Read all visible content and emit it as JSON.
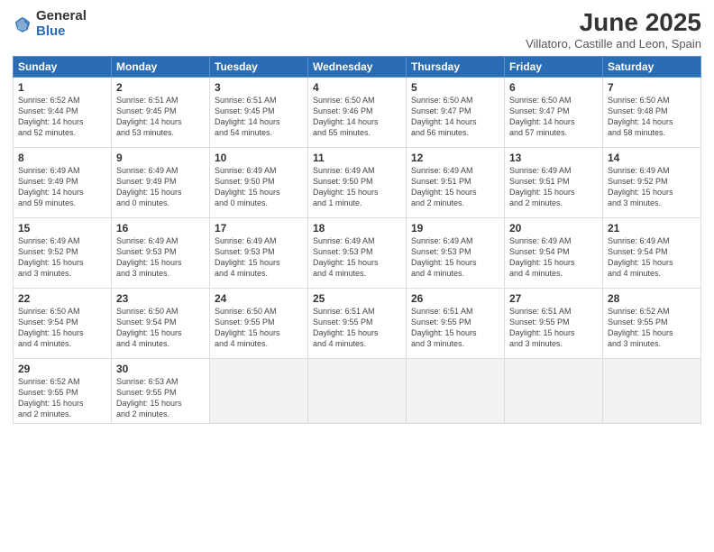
{
  "logo": {
    "general": "General",
    "blue": "Blue"
  },
  "title": "June 2025",
  "subtitle": "Villatoro, Castille and Leon, Spain",
  "headers": [
    "Sunday",
    "Monday",
    "Tuesday",
    "Wednesday",
    "Thursday",
    "Friday",
    "Saturday"
  ],
  "weeks": [
    [
      {
        "day": "1",
        "info": "Sunrise: 6:52 AM\nSunset: 9:44 PM\nDaylight: 14 hours\nand 52 minutes."
      },
      {
        "day": "2",
        "info": "Sunrise: 6:51 AM\nSunset: 9:45 PM\nDaylight: 14 hours\nand 53 minutes."
      },
      {
        "day": "3",
        "info": "Sunrise: 6:51 AM\nSunset: 9:45 PM\nDaylight: 14 hours\nand 54 minutes."
      },
      {
        "day": "4",
        "info": "Sunrise: 6:50 AM\nSunset: 9:46 PM\nDaylight: 14 hours\nand 55 minutes."
      },
      {
        "day": "5",
        "info": "Sunrise: 6:50 AM\nSunset: 9:47 PM\nDaylight: 14 hours\nand 56 minutes."
      },
      {
        "day": "6",
        "info": "Sunrise: 6:50 AM\nSunset: 9:47 PM\nDaylight: 14 hours\nand 57 minutes."
      },
      {
        "day": "7",
        "info": "Sunrise: 6:50 AM\nSunset: 9:48 PM\nDaylight: 14 hours\nand 58 minutes."
      }
    ],
    [
      {
        "day": "8",
        "info": "Sunrise: 6:49 AM\nSunset: 9:49 PM\nDaylight: 14 hours\nand 59 minutes."
      },
      {
        "day": "9",
        "info": "Sunrise: 6:49 AM\nSunset: 9:49 PM\nDaylight: 15 hours\nand 0 minutes."
      },
      {
        "day": "10",
        "info": "Sunrise: 6:49 AM\nSunset: 9:50 PM\nDaylight: 15 hours\nand 0 minutes."
      },
      {
        "day": "11",
        "info": "Sunrise: 6:49 AM\nSunset: 9:50 PM\nDaylight: 15 hours\nand 1 minute."
      },
      {
        "day": "12",
        "info": "Sunrise: 6:49 AM\nSunset: 9:51 PM\nDaylight: 15 hours\nand 2 minutes."
      },
      {
        "day": "13",
        "info": "Sunrise: 6:49 AM\nSunset: 9:51 PM\nDaylight: 15 hours\nand 2 minutes."
      },
      {
        "day": "14",
        "info": "Sunrise: 6:49 AM\nSunset: 9:52 PM\nDaylight: 15 hours\nand 3 minutes."
      }
    ],
    [
      {
        "day": "15",
        "info": "Sunrise: 6:49 AM\nSunset: 9:52 PM\nDaylight: 15 hours\nand 3 minutes."
      },
      {
        "day": "16",
        "info": "Sunrise: 6:49 AM\nSunset: 9:53 PM\nDaylight: 15 hours\nand 3 minutes."
      },
      {
        "day": "17",
        "info": "Sunrise: 6:49 AM\nSunset: 9:53 PM\nDaylight: 15 hours\nand 4 minutes."
      },
      {
        "day": "18",
        "info": "Sunrise: 6:49 AM\nSunset: 9:53 PM\nDaylight: 15 hours\nand 4 minutes."
      },
      {
        "day": "19",
        "info": "Sunrise: 6:49 AM\nSunset: 9:53 PM\nDaylight: 15 hours\nand 4 minutes."
      },
      {
        "day": "20",
        "info": "Sunrise: 6:49 AM\nSunset: 9:54 PM\nDaylight: 15 hours\nand 4 minutes."
      },
      {
        "day": "21",
        "info": "Sunrise: 6:49 AM\nSunset: 9:54 PM\nDaylight: 15 hours\nand 4 minutes."
      }
    ],
    [
      {
        "day": "22",
        "info": "Sunrise: 6:50 AM\nSunset: 9:54 PM\nDaylight: 15 hours\nand 4 minutes."
      },
      {
        "day": "23",
        "info": "Sunrise: 6:50 AM\nSunset: 9:54 PM\nDaylight: 15 hours\nand 4 minutes."
      },
      {
        "day": "24",
        "info": "Sunrise: 6:50 AM\nSunset: 9:55 PM\nDaylight: 15 hours\nand 4 minutes."
      },
      {
        "day": "25",
        "info": "Sunrise: 6:51 AM\nSunset: 9:55 PM\nDaylight: 15 hours\nand 4 minutes."
      },
      {
        "day": "26",
        "info": "Sunrise: 6:51 AM\nSunset: 9:55 PM\nDaylight: 15 hours\nand 3 minutes."
      },
      {
        "day": "27",
        "info": "Sunrise: 6:51 AM\nSunset: 9:55 PM\nDaylight: 15 hours\nand 3 minutes."
      },
      {
        "day": "28",
        "info": "Sunrise: 6:52 AM\nSunset: 9:55 PM\nDaylight: 15 hours\nand 3 minutes."
      }
    ],
    [
      {
        "day": "29",
        "info": "Sunrise: 6:52 AM\nSunset: 9:55 PM\nDaylight: 15 hours\nand 2 minutes."
      },
      {
        "day": "30",
        "info": "Sunrise: 6:53 AM\nSunset: 9:55 PM\nDaylight: 15 hours\nand 2 minutes."
      },
      {
        "day": "",
        "info": ""
      },
      {
        "day": "",
        "info": ""
      },
      {
        "day": "",
        "info": ""
      },
      {
        "day": "",
        "info": ""
      },
      {
        "day": "",
        "info": ""
      }
    ]
  ]
}
